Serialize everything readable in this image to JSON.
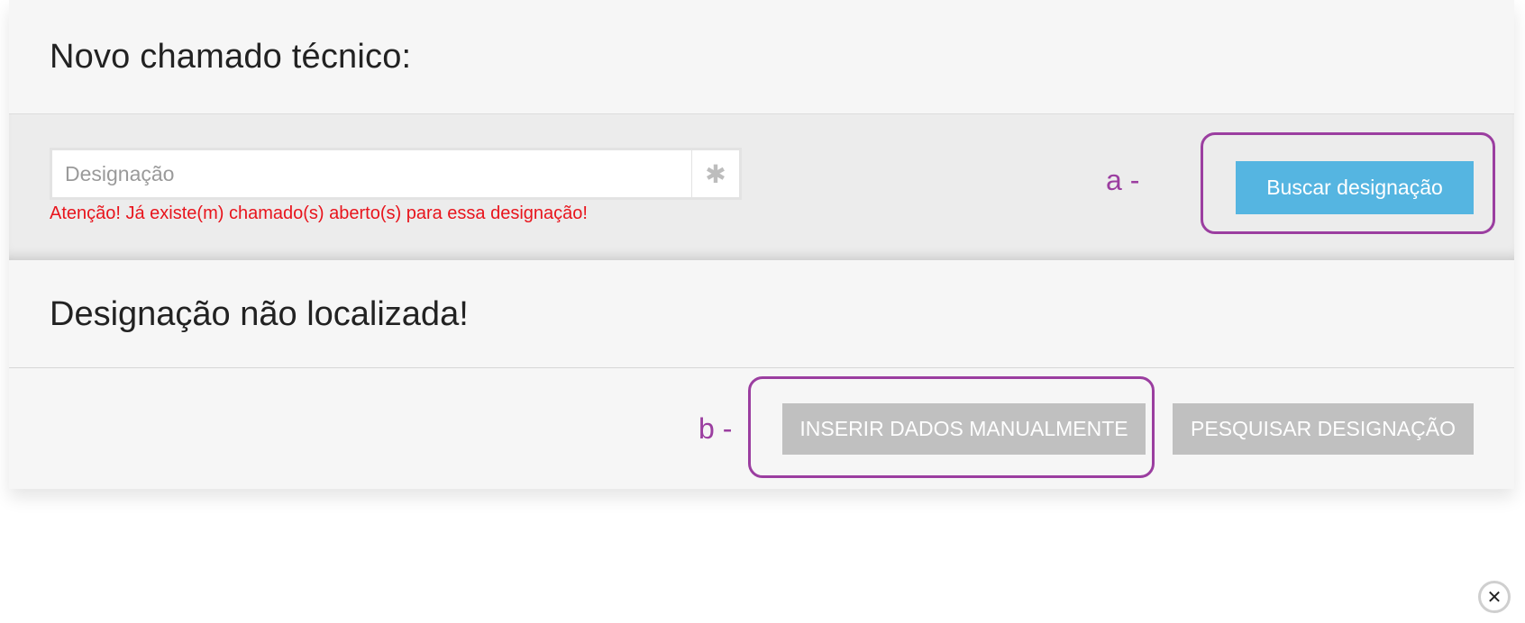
{
  "header": {
    "title": "Novo chamado técnico:"
  },
  "search": {
    "placeholder": "Designação",
    "value": "",
    "required_icon": "asterisk-icon",
    "required_glyph": "✱",
    "warning": "Atenção! Já existe(m) chamado(s) aberto(s) para essa designação!",
    "search_button_label": "Buscar designação"
  },
  "result": {
    "title": "Designação não localizada!",
    "manual_button_label": "INSERIR DADOS MANUALMENTE",
    "search_designation_button_label": "PESQUISAR DESIGNAÇÃO"
  },
  "annotations": {
    "a_label": "a -",
    "b_label": "b -",
    "color": "#9b3ea0"
  },
  "close": {
    "icon": "close-icon",
    "glyph": "✕"
  },
  "colors": {
    "primary_button": "#55b5e1",
    "disabled_button": "#c0c0c0",
    "warning_text": "#e8141c"
  }
}
